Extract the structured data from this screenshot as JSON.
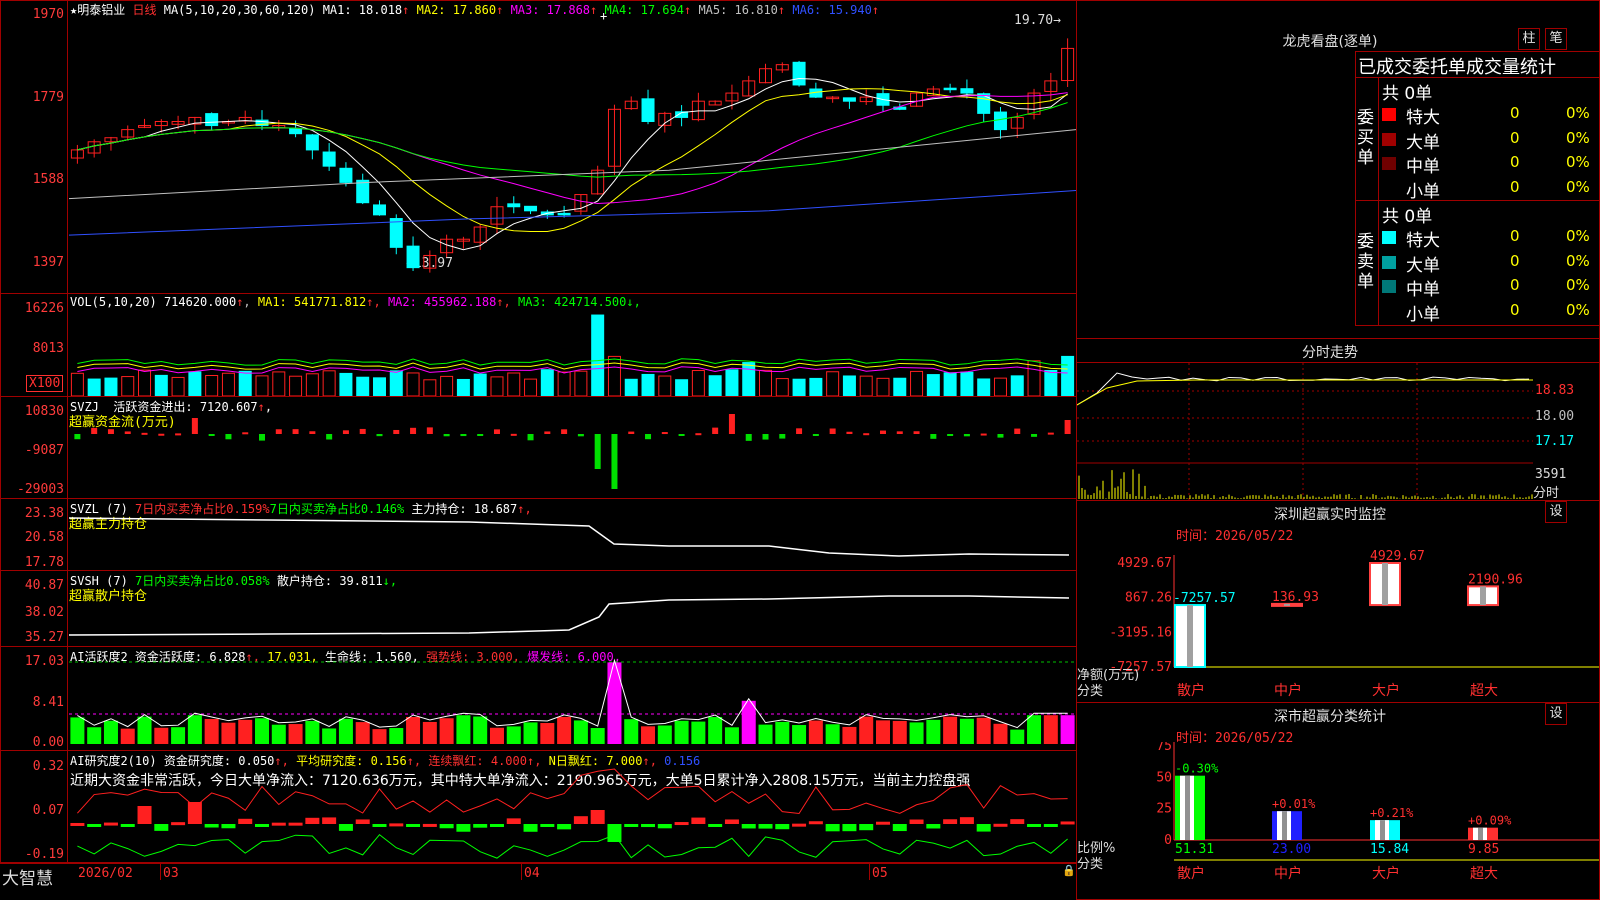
{
  "stock": {
    "star": "★",
    "name": "明泰铝业",
    "period": "日线"
  },
  "main": {
    "ma_label": "MA(5,10,20,30,60,120)",
    "ma": [
      {
        "name": "MA1",
        "value": "18.018",
        "arrow": "↑",
        "color": "#ffffff"
      },
      {
        "name": "MA2",
        "value": "17.860",
        "arrow": "↑",
        "color": "#ffff00"
      },
      {
        "name": "MA3",
        "value": "17.868",
        "arrow": "↑",
        "color": "#ff00ff"
      },
      {
        "name": "MA4",
        "value": "17.694",
        "arrow": "↑",
        "color": "#00ff00"
      },
      {
        "name": "MA5",
        "value": "16.810",
        "arrow": "↑",
        "color": "#c0c0c0"
      },
      {
        "name": "MA6",
        "value": "15.940",
        "arrow": "↑",
        "color": "#3050ff"
      }
    ],
    "yticks": [
      "1970",
      "1779",
      "1588",
      "1397"
    ],
    "high_mark": "19.70",
    "low_mark": "13.97"
  },
  "vol": {
    "label": "VOL(5,10,20)",
    "value": "714620.000",
    "ma": [
      {
        "name": "MA1",
        "value": "541771.812",
        "arrow": "↑",
        "color": "#ffff00"
      },
      {
        "name": "MA2",
        "value": "455962.188",
        "arrow": "↑",
        "color": "#ff00ff"
      },
      {
        "name": "MA3",
        "value": "424714.500",
        "arrow": "↓",
        "color": "#00ff00"
      }
    ],
    "yticks": [
      "16226",
      "8013"
    ],
    "unit": "X100"
  },
  "svzj": {
    "label": "SVZJ",
    "desc": "活跃资金进出:",
    "value": "7120.607",
    "arrow": "↑",
    "subtitle": "超赢资金流(万元)",
    "yticks": [
      "10830",
      "-9087",
      "-29003"
    ]
  },
  "svzl": {
    "label": "SVZL (7)",
    "t1": "7日内买卖净占比0.159%",
    "t2": "7日内买卖净占比0.146%",
    "t3": "主力持仓:",
    "value": "18.687",
    "arrow": "↑,",
    "subtitle": "超赢主力持仓",
    "yticks": [
      "23.38",
      "20.58",
      "17.78"
    ]
  },
  "svsh": {
    "label": "SVSH (7)",
    "t1": "7日内买卖净占比0.058%",
    "t2": "散户持仓:",
    "value": "39.811",
    "arrow": "↓,",
    "subtitle": "超赢散户持仓",
    "yticks": [
      "40.87",
      "38.02",
      "35.27"
    ]
  },
  "ai_active": {
    "label": "AI活跃度2",
    "t1": "资金活跃度:",
    "v1": "6.828",
    "v2": "17.031,",
    "t3": "生命线:",
    "v3": "1.560,",
    "t4": "强势线:",
    "v4": "3.000,",
    "t5": "爆发线:",
    "v5": "6.000,",
    "yticks": [
      "17.03",
      "8.41",
      "0.00"
    ]
  },
  "ai_research": {
    "label": "AI研究度2(10)",
    "t1": "资金研究度:",
    "v1": "0.050",
    "t2": "平均研究度:",
    "v2": "0.156",
    "t3": "连续飘红:",
    "v3": "4.000",
    "t4": "N日飘红:",
    "v4": "7.000",
    "v5": "0.156",
    "summary": "近期大资金非常活跃，今日大单净流入：7120.636万元，其中特大单净流入：2190.965万元，大单5日累计净入2808.15万元，当前主力控盘强",
    "yticks": [
      "0.32",
      "0.07",
      "-0.19"
    ]
  },
  "bottom": {
    "brand": "大智慧",
    "dates": [
      "2026/02",
      "03",
      "04",
      "05"
    ]
  },
  "tiger": {
    "title": "龙虎看盘(逐单)",
    "btn1": "柱",
    "btn2": "笔",
    "subtitle": "已成交委托单成交量统计",
    "buy": {
      "side": "委买单",
      "total": "共 0单",
      "rows": [
        {
          "label": "特大",
          "count": "0",
          "pct": "0%",
          "color": "#ff0000"
        },
        {
          "label": "大单",
          "count": "0",
          "pct": "0%",
          "color": "#a00000"
        },
        {
          "label": "中单",
          "count": "0",
          "pct": "0%",
          "color": "#700000"
        },
        {
          "label": "小单",
          "count": "0",
          "pct": "0%",
          "color": ""
        }
      ]
    },
    "sell": {
      "side": "委卖单",
      "total": "共 0单",
      "rows": [
        {
          "label": "特大",
          "count": "0",
          "pct": "0%",
          "color": "#00ffff"
        },
        {
          "label": "大单",
          "count": "0",
          "pct": "0%",
          "color": "#00a0a0"
        },
        {
          "label": "中单",
          "count": "0",
          "pct": "0%",
          "color": "#007878"
        },
        {
          "label": "小单",
          "count": "0",
          "pct": "0%",
          "color": ""
        }
      ]
    }
  },
  "intraday": {
    "title": "分时走势",
    "yticks": [
      "18.83",
      "18.00",
      "17.17",
      "3591",
      "分时"
    ]
  },
  "sz_monitor": {
    "title": "深圳超赢实时监控",
    "btn": "设",
    "time": "时间：2026/05/22",
    "yticks": [
      "4929.67",
      "867.26",
      "-3195.16",
      "-7257.57"
    ],
    "ylabel": "净额(万元)",
    "xlabel": "分类",
    "bars": [
      {
        "cat": "散户",
        "value": -7257.57,
        "label": "-7257.57"
      },
      {
        "cat": "中户",
        "value": 136.93,
        "label": "136.93"
      },
      {
        "cat": "大户",
        "value": 4929.67,
        "label": "4929.67"
      },
      {
        "cat": "超大",
        "value": 2190.96,
        "label": "2190.96"
      }
    ]
  },
  "sz_class": {
    "title": "深市超赢分类统计",
    "btn": "设",
    "time": "时间：2026/05/22",
    "yticks": [
      "75",
      "50",
      "25",
      "0"
    ],
    "ylabel": "比例%",
    "xlabel": "分类",
    "bars": [
      {
        "cat": "散户",
        "value": 51.31,
        "label": "51.31",
        "change": "-0.30%"
      },
      {
        "cat": "中户",
        "value": 23.0,
        "label": "23.00",
        "change": "+0.01%"
      },
      {
        "cat": "大户",
        "value": 15.84,
        "label": "15.84",
        "change": "+0.21%"
      },
      {
        "cat": "超大",
        "value": 9.85,
        "label": "9.85",
        "change": "+0.09%"
      }
    ]
  },
  "colors": {
    "up": "#ff2020",
    "down": "#00ffff",
    "grid": "#a00000",
    "text": "#c0c0c0"
  }
}
